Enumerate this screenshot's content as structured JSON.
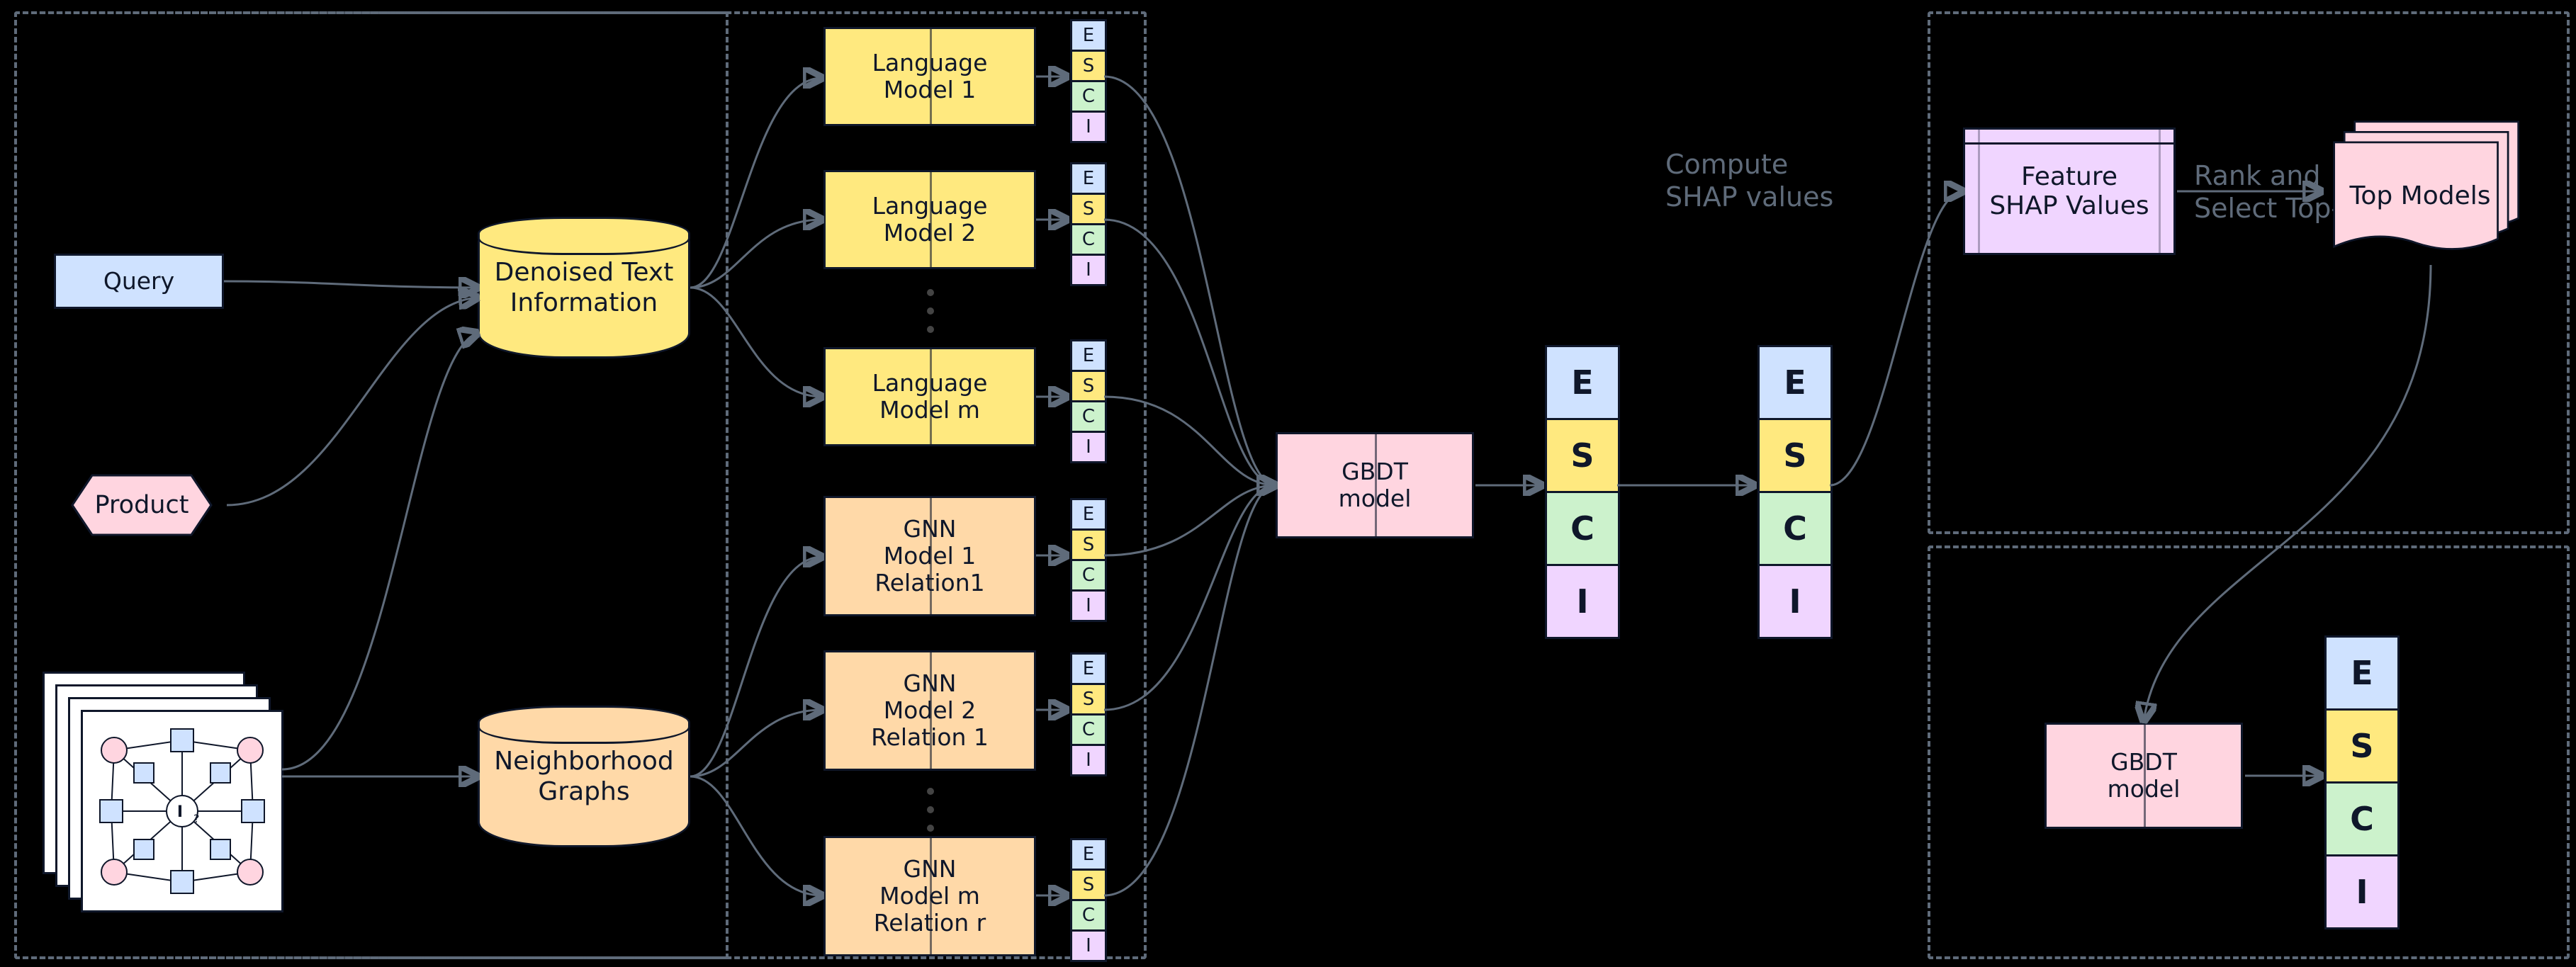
{
  "inputs": {
    "query": "Query",
    "product": "Product",
    "graphNodeLabel": "I",
    "graphNodeUnknown": "?"
  },
  "stores": {
    "denoised": "Denoised Text\nInformation",
    "neighborhood": "Neighborhood\nGraphs"
  },
  "langModels": [
    "Language\nModel 1",
    "Language\nModel 2",
    "Language\nModel m"
  ],
  "gnnModels": [
    "GNN\nModel 1\nRelation1",
    "GNN\nModel 2\nRelation 1",
    "GNN\nModel m\nRelation r"
  ],
  "esciMini": [
    "E",
    "S",
    "C",
    "I"
  ],
  "esciBig": [
    "E",
    "S",
    "C",
    "I"
  ],
  "gbdt": "GBDT\nmodel",
  "labels": {
    "shap": "Compute\nSHAP values",
    "rank": "Rank and\nSelect Top-K",
    "featureShap": "Feature\nSHAP Values",
    "topModels": "Top Models"
  },
  "chart_data": {
    "type": "table",
    "description": "Architecture diagram: inputs feed two data stores, fan out to m language-model heads and m×r GNN heads each producing ESCI scores, aggregated by a GBDT model, whose SHAP values rank features to select top-K models, which feed a second GBDT producing final ESCI.",
    "esci_classes": [
      "E",
      "S",
      "C",
      "I"
    ],
    "language_model_heads": "m",
    "gnn_heads": "m × r"
  }
}
